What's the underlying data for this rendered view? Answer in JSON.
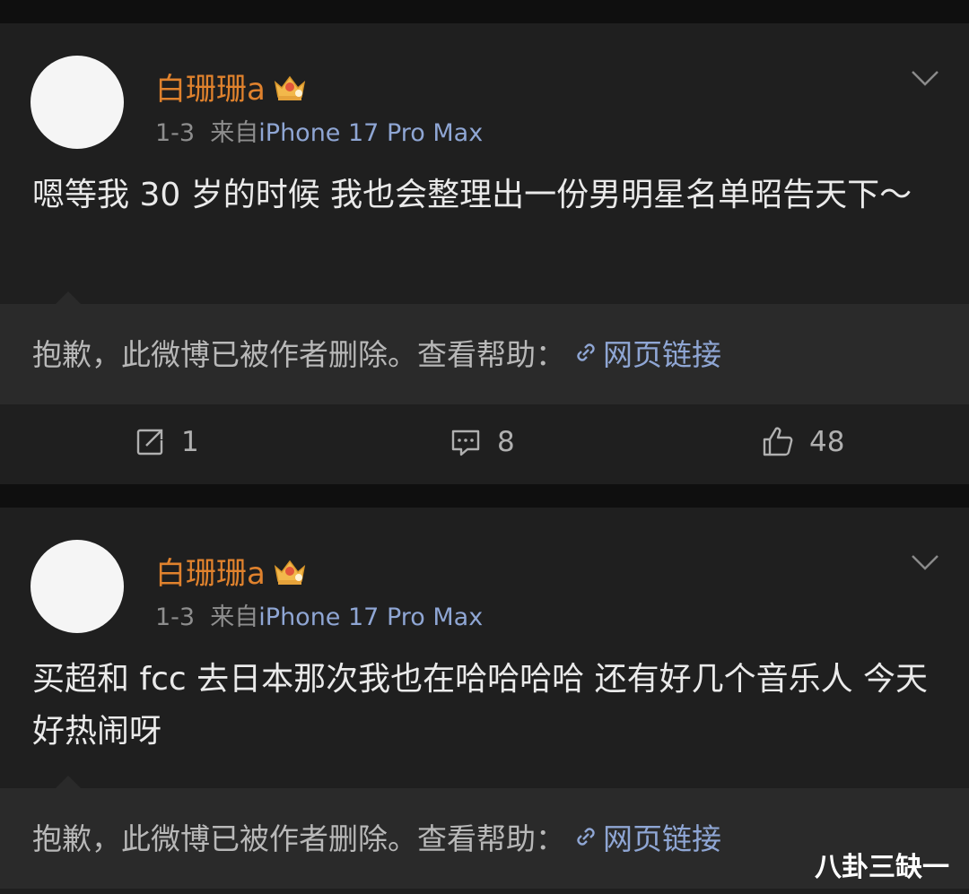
{
  "posts": [
    {
      "username": "白珊珊a",
      "date": "1-3",
      "source_prefix": "来自",
      "device": "iPhone 17 Pro Max",
      "content": "嗯等我 30 岁的时候 我也会整理出一份男明星名单昭告天下～",
      "deleted_notice": "抱歉，此微博已被作者删除。查看帮助：",
      "link_label": "网页链接",
      "repost_count": "1",
      "comment_count": "8",
      "like_count": "48"
    },
    {
      "username": "白珊珊a",
      "date": "1-3",
      "source_prefix": "来自",
      "device": "iPhone 17 Pro Max",
      "content": "买超和 fcc 去日本那次我也在哈哈哈哈 还有好几个音乐人 今天好热闹呀",
      "deleted_notice": "抱歉，此微博已被作者删除。查看帮助：",
      "link_label": "网页链接"
    }
  ],
  "watermark": "八卦三缺一",
  "colors": {
    "username": "#e0822d",
    "device": "#8fa6d4",
    "link": "#8fa6d4",
    "card_bg": "#1f1f1f",
    "repost_bg": "#2a2a2a"
  },
  "icons": {
    "badge": "crown-badge-icon",
    "more": "chevron-down-icon",
    "link": "link-icon",
    "repost": "repost-icon",
    "comment": "comment-icon",
    "like": "thumbs-up-icon"
  }
}
